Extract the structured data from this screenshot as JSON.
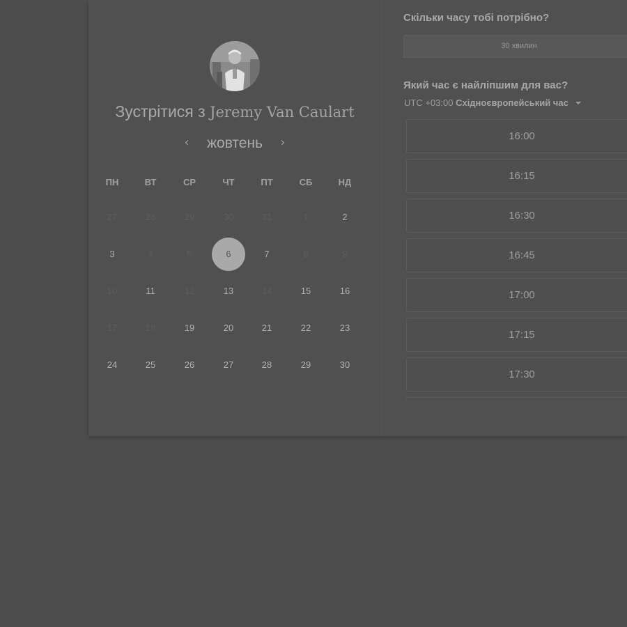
{
  "meeting": {
    "prefix": "Зустрітися з",
    "host_name": "Jeremy Van Caulart"
  },
  "calendar": {
    "month": "жовтень",
    "prev_icon": "chevron-left-icon",
    "next_icon": "chevron-right-icon",
    "weekdays": [
      "ПН",
      "ВТ",
      "СР",
      "ЧТ",
      "ПТ",
      "СБ",
      "НД"
    ],
    "weeks": [
      [
        "27",
        "28",
        "29",
        "30",
        "31",
        "1",
        "2"
      ],
      [
        "3",
        "4",
        "5",
        "6",
        "7",
        "8",
        "9"
      ],
      [
        "10",
        "11",
        "12",
        "13",
        "14",
        "15",
        "16"
      ],
      [
        "17",
        "18",
        "19",
        "20",
        "21",
        "22",
        "23"
      ],
      [
        "24",
        "25",
        "26",
        "27",
        "28",
        "29",
        "30"
      ]
    ],
    "selected_day": "6"
  },
  "duration": {
    "question": "Скільки часу тобі потрібно?",
    "selected": "30 хвилин"
  },
  "time": {
    "question": "Який час є найліпшим для вас?",
    "tz_offset": "UTC +03:00",
    "tz_name": "Східноєвропейський час",
    "slots": [
      "16:00",
      "16:15",
      "16:30",
      "16:45",
      "17:00",
      "17:15",
      "17:30"
    ]
  },
  "colors": {
    "overlay": "#4d4d4d",
    "card": "#505050",
    "selected_day": "#a9a9a9"
  }
}
